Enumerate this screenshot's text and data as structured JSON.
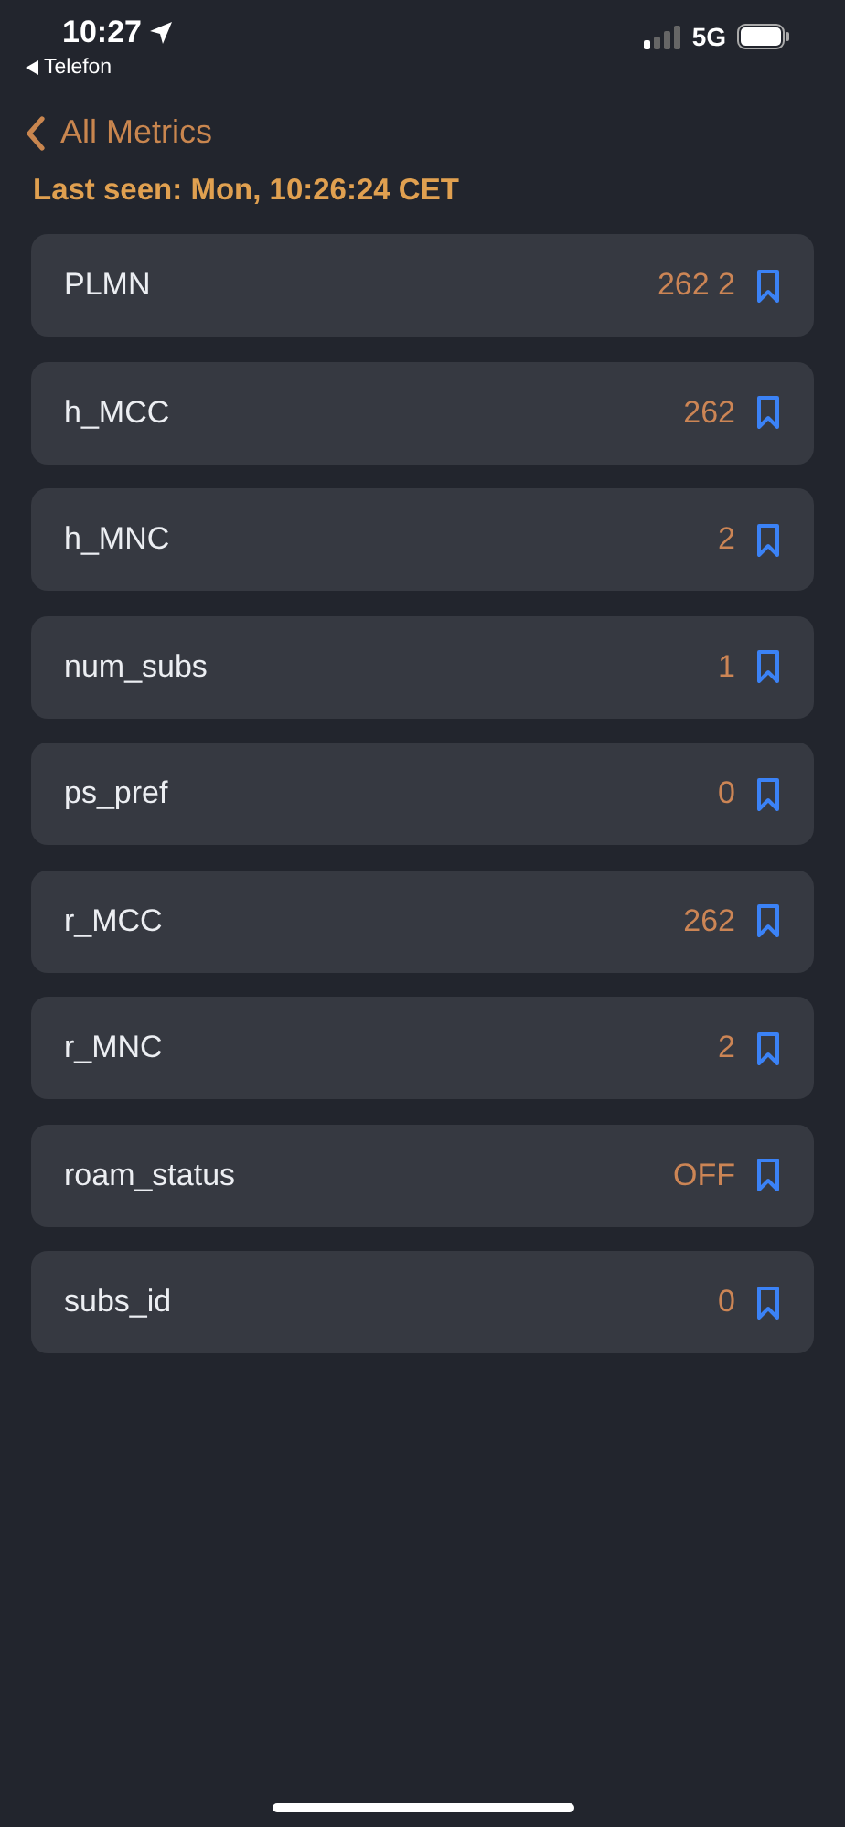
{
  "status_bar": {
    "time": "10:27",
    "back_app": "Telefon",
    "network": "5G"
  },
  "nav": {
    "back_label": "All Metrics"
  },
  "last_seen": "Last seen: Mon, 10:26:24 CET",
  "metrics": [
    {
      "name": "PLMN",
      "value": "262 2"
    },
    {
      "name": "h_MCC",
      "value": "262"
    },
    {
      "name": "h_MNC",
      "value": "2"
    },
    {
      "name": "num_subs",
      "value": "1"
    },
    {
      "name": "ps_pref",
      "value": "0"
    },
    {
      "name": "r_MCC",
      "value": "262"
    },
    {
      "name": "r_MNC",
      "value": "2"
    },
    {
      "name": "roam_status",
      "value": "OFF"
    },
    {
      "name": "subs_id",
      "value": "0"
    }
  ]
}
